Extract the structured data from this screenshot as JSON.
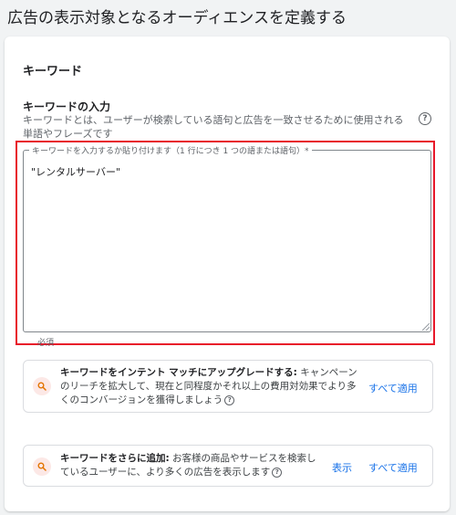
{
  "page": {
    "title": "広告の表示対象となるオーディエンスを定義する"
  },
  "section": {
    "title": "キーワード"
  },
  "keyword_input": {
    "heading": "キーワードの入力",
    "description": "キーワードとは、ユーザーが検索している語句と広告を一致させるために使用される単語やフレーズです",
    "help_icon": "help-circle-icon",
    "label": "キーワードを入力するか貼り付けます（1 行につき 1 つの語または語句）*",
    "value": "\"レンタルサーバー\"",
    "required_hint": "必須",
    "highlight_color": "#e8182a"
  },
  "suggestions": [
    {
      "icon": "search-icon",
      "bold": "キーワードをインテント マッチにアップグレードする:",
      "text": " キャンペーンのリーチを拡大して、現在と同程度かそれ以上の費用対効果でより多くのコンバージョンを獲得しましょう",
      "apply_all": "すべて適用"
    },
    {
      "icon": "search-icon",
      "bold": "キーワードをさらに追加:",
      "text": " お客様の商品やサービスを検索しているユーザーに、より多くの広告を表示します",
      "show": "表示",
      "apply_all": "すべて適用"
    }
  ],
  "colors": {
    "link": "#1a73e8",
    "icon_bg": "#fce8e6",
    "icon_fg": "#e37400"
  }
}
